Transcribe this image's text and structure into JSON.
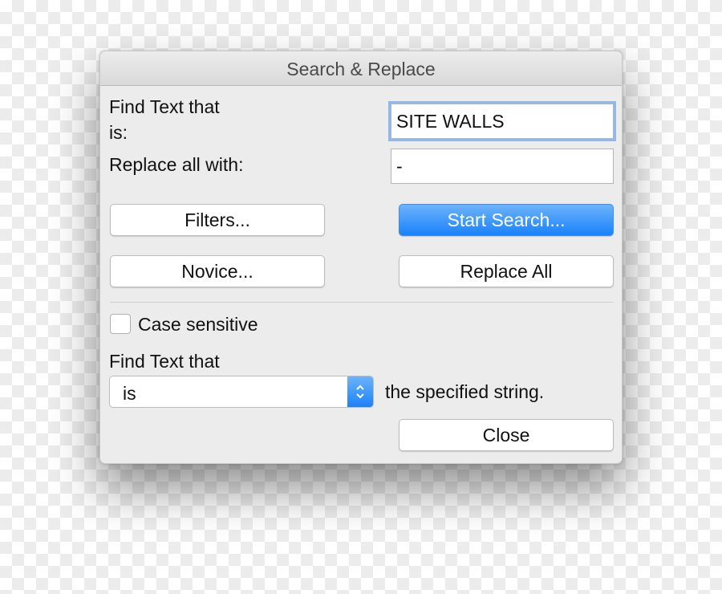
{
  "window": {
    "title": "Search & Replace"
  },
  "find": {
    "label_line1": "Find Text that",
    "label_line2": "is:",
    "value": "SITE WALLS"
  },
  "replace": {
    "label": "Replace all with:",
    "value": "-"
  },
  "buttons": {
    "filters": "Filters...",
    "start_search": "Start Search...",
    "novice": "Novice...",
    "replace_all": "Replace All",
    "close": "Close"
  },
  "case_sensitive": {
    "label": "Case sensitive",
    "checked": false
  },
  "match": {
    "label": "Find Text that",
    "selected": "is",
    "suffix": "the specified string."
  },
  "colors": {
    "accent": "#1a82fb",
    "focus_ring": "#8db9ee",
    "dialog_bg": "#ececec"
  },
  "icons": {
    "stepper": "chevron-up-down-icon"
  }
}
